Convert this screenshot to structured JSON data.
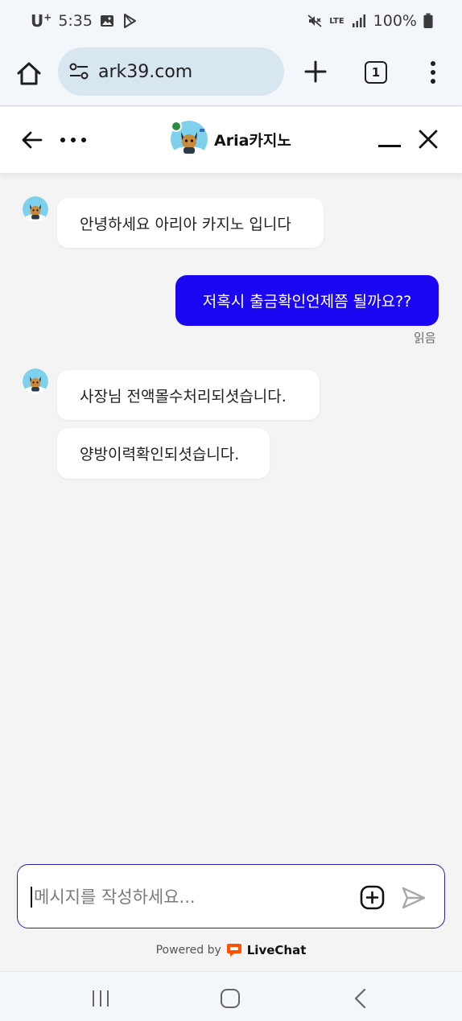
{
  "status_bar": {
    "carrier": "U",
    "carrier_sup": "+",
    "time": "5:35",
    "network": "LTE",
    "battery": "100%"
  },
  "browser": {
    "url": "ark39.com",
    "tab_count": "1"
  },
  "chat_header": {
    "agent_name": "Aria카지노"
  },
  "messages": [
    {
      "from": "agent",
      "text": "안녕하세요 아리아 카지노 입니다"
    },
    {
      "from": "user",
      "text": "저혹시 출금확인언제쯤 될까요??",
      "status": "읽음"
    },
    {
      "from": "agent",
      "text": "사장님 전액몰수처리되셧습니다."
    },
    {
      "from": "agent",
      "text": "양방이력확인되셧습니다."
    }
  ],
  "composer": {
    "placeholder": "메시지를 작성하세요..."
  },
  "footer": {
    "powered_by": "Powered by",
    "brand": "LiveChat"
  },
  "colors": {
    "user_bubble": "#1a06f0",
    "online": "#2c8a43",
    "livechat_orange": "#ff5100",
    "composer_border": "#2a1fa8"
  }
}
